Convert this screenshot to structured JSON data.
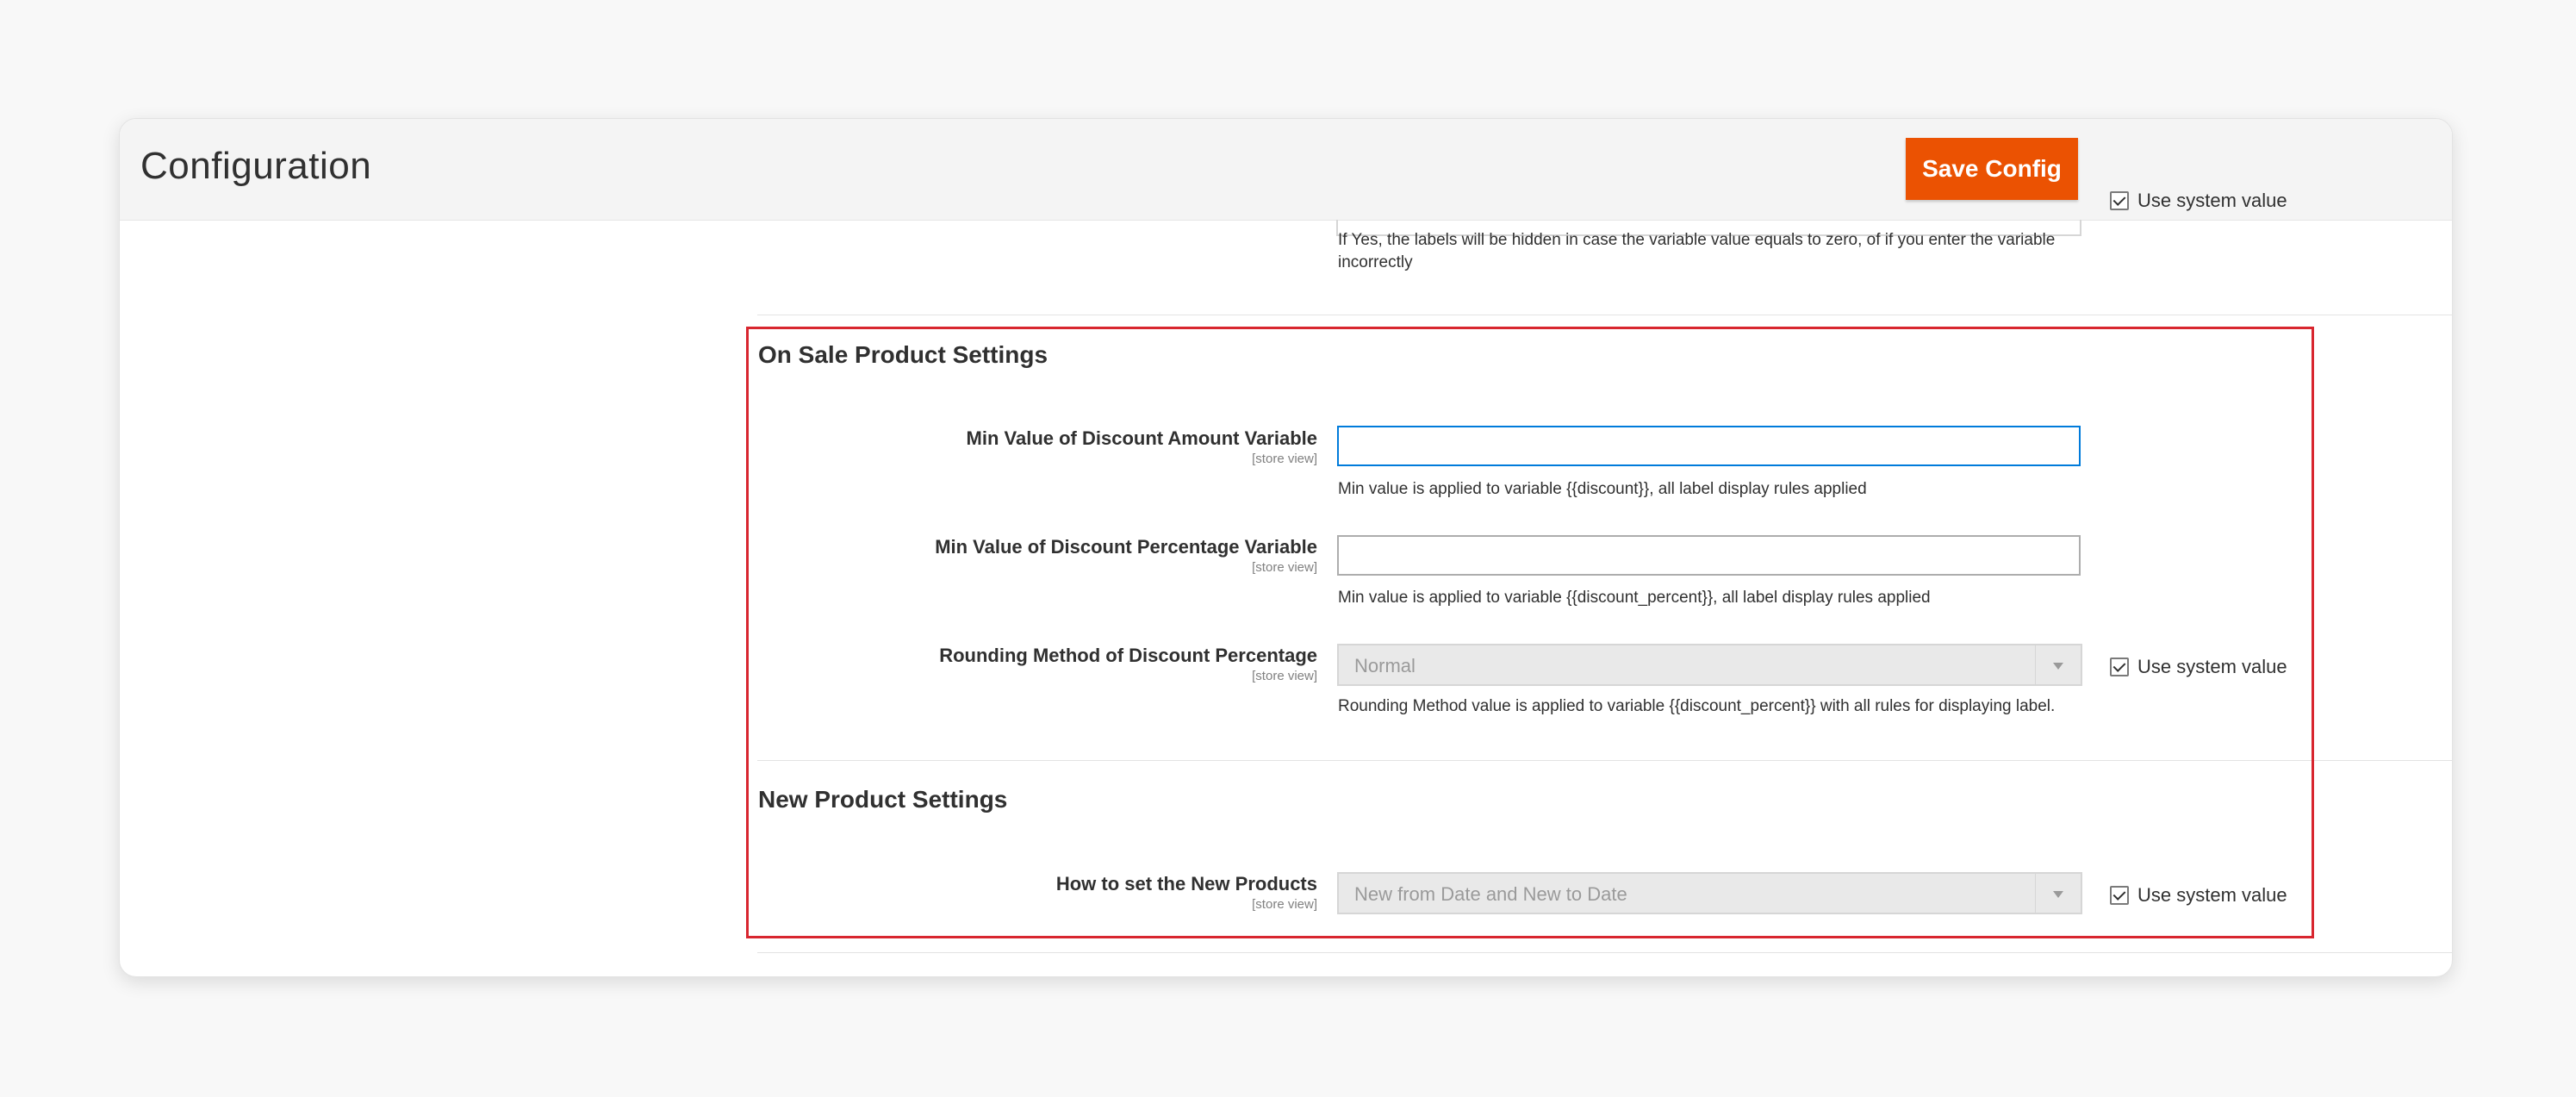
{
  "header": {
    "title": "Configuration",
    "save_label": "Save Config"
  },
  "top_field": {
    "hint": "If Yes, the labels will be hidden in case the variable value equals to zero, of if you enter the variable incorrectly",
    "use_system_value": "Use system value"
  },
  "on_sale": {
    "title": "On Sale Product Settings",
    "fields": [
      {
        "label": "Min Value of Discount Amount Variable",
        "scope": "[store view]",
        "value": "",
        "hint": "Min value is applied to variable {{discount}}, all label display rules applied"
      },
      {
        "label": "Min Value of Discount Percentage Variable",
        "scope": "[store view]",
        "value": "",
        "hint": "Min value is applied to variable {{discount_percent}}, all label display rules applied"
      },
      {
        "label": "Rounding Method of Discount Percentage",
        "scope": "[store view]",
        "selected": "Normal",
        "hint": "Rounding Method value is applied to variable {{discount_percent}} with all rules for displaying label.",
        "use_system_value": "Use system value"
      }
    ]
  },
  "new_product": {
    "title": "New Product Settings",
    "fields": [
      {
        "label": "How to set the New Products",
        "scope": "[store view]",
        "selected": "New from Date and New to Date",
        "use_system_value": "Use system value"
      }
    ]
  },
  "colors": {
    "accent": "#eb5202",
    "focus": "#007bdb",
    "highlight": "#d8262f"
  }
}
